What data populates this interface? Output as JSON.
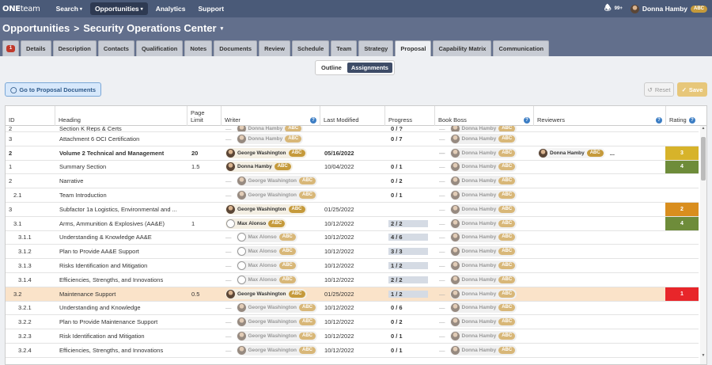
{
  "nav": {
    "logo_bold": "ONE",
    "logo_light": "team",
    "links": [
      {
        "label": "Search",
        "caret": true,
        "active": false
      },
      {
        "label": "Opportunities",
        "caret": true,
        "active": true
      },
      {
        "label": "Analytics",
        "caret": false,
        "active": false
      },
      {
        "label": "Support",
        "caret": false,
        "active": false
      }
    ],
    "notif_count": "99+",
    "user_name": "Donna Hamby",
    "user_badge": "ABC"
  },
  "header": {
    "crumb_root": "Opportunities",
    "crumb_sep": ">",
    "crumb_current": "Security Operations Center"
  },
  "tabs": [
    {
      "label": "Details"
    },
    {
      "label": "Description"
    },
    {
      "label": "Contacts"
    },
    {
      "label": "Qualification"
    },
    {
      "label": "Notes"
    },
    {
      "label": "Documents"
    },
    {
      "label": "Review"
    },
    {
      "label": "Schedule"
    },
    {
      "label": "Team"
    },
    {
      "label": "Strategy"
    },
    {
      "label": "Proposal",
      "active": true
    },
    {
      "label": "Capability Matrix"
    },
    {
      "label": "Communication"
    }
  ],
  "alert_tab_count": "1",
  "subtabs": [
    {
      "label": "Outline",
      "active": false
    },
    {
      "label": "Assignments",
      "active": true
    }
  ],
  "toolbar": {
    "go_label": "Go to Proposal Documents",
    "reset_label": "Reset",
    "save_label": "Save"
  },
  "columns": {
    "id": "ID",
    "heading": "Heading",
    "limit_l1": "Page",
    "limit_l2": "Limit",
    "writer": "Writer",
    "modified": "Last Modified",
    "progress": "Progress",
    "boss": "Book Boss",
    "reviewers": "Reviewers",
    "rating": "Rating"
  },
  "colors": {
    "nav_bg": "#4a5a78",
    "header_bg": "#626f8c",
    "badge": "#c59a3b",
    "rating_yellow": "#d7b32a",
    "rating_green": "#6e8c3a",
    "rating_orange": "#d98e1e",
    "rating_red": "#e8262a",
    "selected_row": "#fae3c9"
  },
  "rows": [
    {
      "id": "2",
      "heading": "Section K Reps & Certs",
      "limit": "",
      "writer": "Donna Hamby",
      "writer_dim": true,
      "modified": "",
      "progress": "0 / ?",
      "boss": "Donna Hamby",
      "reviewers": "",
      "rating": "",
      "partial": true
    },
    {
      "id": "3",
      "heading": "Attachment 6 OCI Certification",
      "limit": "",
      "writer": "Donna Hamby",
      "writer_dim": true,
      "modified": "",
      "progress": "0 / 7",
      "boss": "Donna Hamby",
      "reviewers": "",
      "rating": ""
    },
    {
      "id": "2",
      "heading": "Volume 2 Technical and Management",
      "limit": "20",
      "writer": "George Washington",
      "writer_dim": false,
      "modified": "05/16/2022",
      "progress": "",
      "boss": "Donna Hamby",
      "reviewers": "Donna Hamby",
      "rating": "3",
      "rating_color": "#d7b32a",
      "bold": true
    },
    {
      "id": "1",
      "heading": "Summary Section",
      "limit": "1.5",
      "writer": "Donna Hamby",
      "writer_dim": false,
      "modified": "10/04/2022",
      "progress": "0 / 1",
      "boss": "Donna Hamby",
      "reviewers": "",
      "rating": "4",
      "rating_color": "#6e8c3a"
    },
    {
      "id": "2",
      "heading": "Narrative",
      "limit": "",
      "writer": "George Washington",
      "writer_dim": true,
      "modified": "",
      "progress": "0 / 2",
      "boss": "Donna Hamby",
      "reviewers": "",
      "rating": ""
    },
    {
      "id": "2.1",
      "heading": "Team Introduction",
      "limit": "",
      "writer": "George Washington",
      "writer_dim": true,
      "modified": "",
      "progress": "0 / 1",
      "boss": "Donna Hamby",
      "reviewers": "",
      "rating": ""
    },
    {
      "id": "3",
      "heading": "Subfactor 1a Logistics, Environmental and ...",
      "limit": "",
      "writer": "George Washington",
      "writer_dim": false,
      "modified": "01/25/2022",
      "progress": "",
      "boss": "Donna Hamby",
      "reviewers": "",
      "rating": "2",
      "rating_color": "#d98e1e"
    },
    {
      "id": "3.1",
      "heading": "Arms, Ammunition & Explosives (AA&E)",
      "limit": "1",
      "writer": "Max Alonso",
      "writer_dim": false,
      "generic": true,
      "modified": "10/12/2022",
      "progress": "2 / 2",
      "progress_bar": true,
      "boss": "Donna Hamby",
      "reviewers": "",
      "rating": "4",
      "rating_color": "#6e8c3a"
    },
    {
      "id": "3.1.1",
      "heading": "Understanding & Knowledge AA&E",
      "limit": "",
      "writer": "Max Alonso",
      "writer_dim": true,
      "generic": true,
      "modified": "10/12/2022",
      "progress": "4 / 6",
      "progress_bar": true,
      "boss": "Donna Hamby",
      "reviewers": "",
      "rating": ""
    },
    {
      "id": "3.1.2",
      "heading": "Plan to Provide AA&E Support",
      "limit": "",
      "writer": "Max Alonso",
      "writer_dim": true,
      "generic": true,
      "modified": "10/12/2022",
      "progress": "3 / 3",
      "progress_bar": true,
      "boss": "Donna Hamby",
      "reviewers": "",
      "rating": ""
    },
    {
      "id": "3.1.3",
      "heading": "Risks Identification and Mitigation",
      "limit": "",
      "writer": "Max Alonso",
      "writer_dim": true,
      "generic": true,
      "modified": "10/12/2022",
      "progress": "1 / 2",
      "progress_bar": true,
      "boss": "Donna Hamby",
      "reviewers": "",
      "rating": ""
    },
    {
      "id": "3.1.4",
      "heading": "Efficiencies, Strengths, and Innovations",
      "limit": "",
      "writer": "Max Alonso",
      "writer_dim": true,
      "generic": true,
      "modified": "10/12/2022",
      "progress": "2 / 2",
      "progress_bar": true,
      "boss": "Donna Hamby",
      "reviewers": "",
      "rating": ""
    },
    {
      "id": "3.2",
      "heading": "Maintenance Support",
      "limit": "0.5",
      "writer": "George Washington",
      "writer_dim": false,
      "modified": "01/25/2022",
      "progress": "1 / 2",
      "progress_bar": true,
      "boss": "Donna Hamby",
      "reviewers": "",
      "rating": "1",
      "rating_color": "#e8262a",
      "selected": true
    },
    {
      "id": "3.2.1",
      "heading": "Understanding and Knowledge",
      "limit": "",
      "writer": "George Washington",
      "writer_dim": true,
      "modified": "10/12/2022",
      "progress": "0 / 6",
      "boss": "Donna Hamby",
      "reviewers": "",
      "rating": ""
    },
    {
      "id": "3.2.2",
      "heading": "Plan to Provide Maintenance Support",
      "limit": "",
      "writer": "George Washington",
      "writer_dim": true,
      "modified": "10/12/2022",
      "progress": "0 / 2",
      "boss": "Donna Hamby",
      "reviewers": "",
      "rating": ""
    },
    {
      "id": "3.2.3",
      "heading": "Risk Identification and Mitigation",
      "limit": "",
      "writer": "George Washington",
      "writer_dim": true,
      "modified": "10/12/2022",
      "progress": "0 / 1",
      "boss": "Donna Hamby",
      "reviewers": "",
      "rating": ""
    },
    {
      "id": "3.2.4",
      "heading": "Efficiencies, Strengths, and Innovations",
      "limit": "",
      "writer": "George Washington",
      "writer_dim": true,
      "modified": "10/12/2022",
      "progress": "0 / 1",
      "boss": "Donna Hamby",
      "reviewers": "",
      "rating": ""
    }
  ],
  "badge_text": "ABC",
  "reviewer_more": "..."
}
